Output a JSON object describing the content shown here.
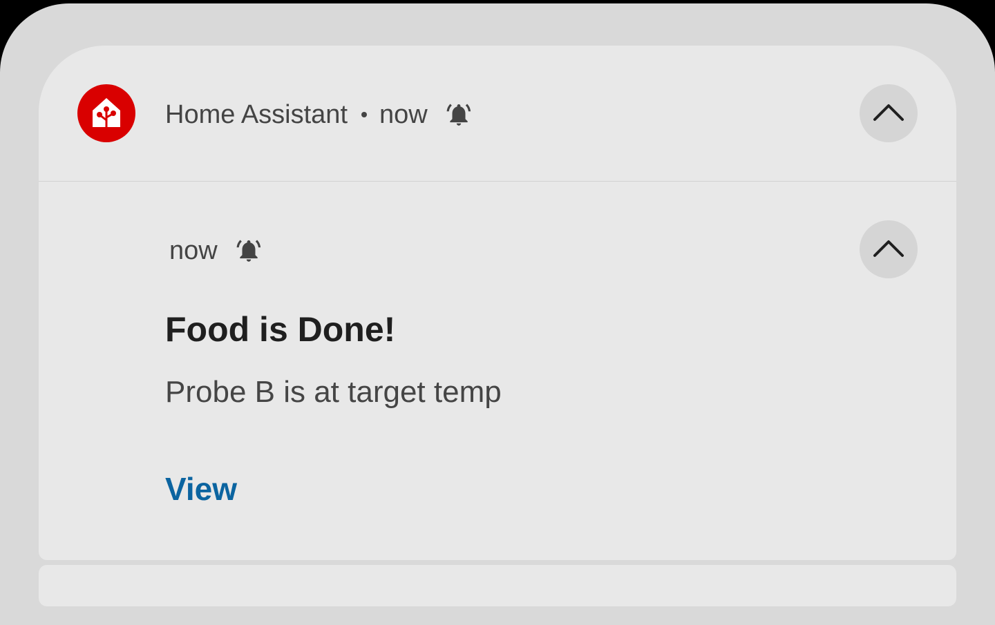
{
  "notification": {
    "app_name": "Home Assistant",
    "separator": "•",
    "header_time": "now",
    "app_icon": "home-assistant-icon",
    "alert_icon": "bell-ringing-icon",
    "expand_icon": "chevron-up-icon",
    "brand_color": "#d90000"
  },
  "message": {
    "time": "now",
    "title": "Food is Done!",
    "body": "Probe B is at target temp",
    "action_label": "View",
    "action_color": "#0b64a0"
  }
}
